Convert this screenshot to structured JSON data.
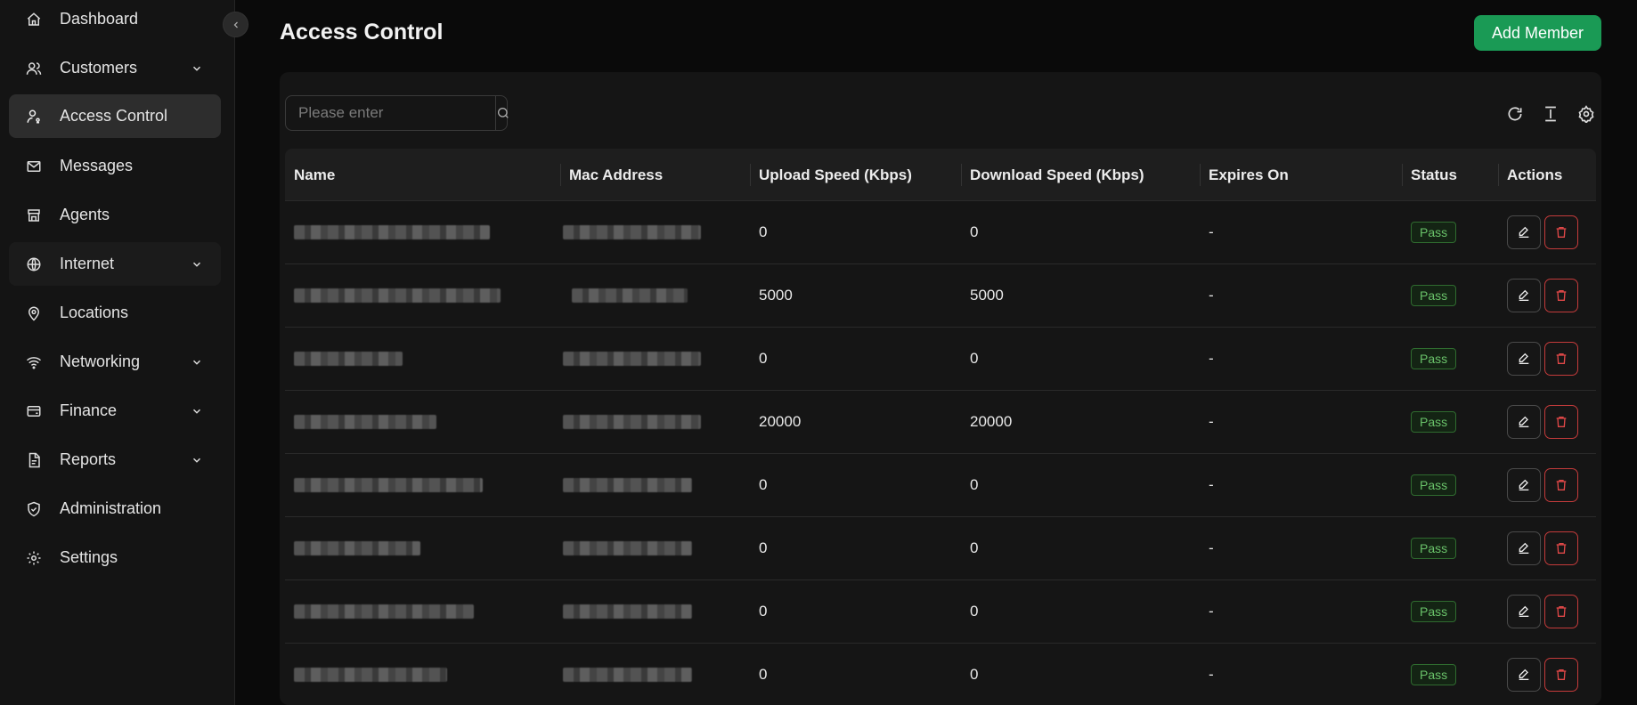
{
  "sidebar": {
    "items": [
      {
        "label": "Dashboard",
        "icon": "home-icon",
        "chevron": false
      },
      {
        "label": "Customers",
        "icon": "users-icon",
        "chevron": true
      },
      {
        "label": "Access Control",
        "icon": "user-key-icon",
        "chevron": false,
        "active": true
      },
      {
        "label": "Messages",
        "icon": "mail-icon",
        "chevron": false
      },
      {
        "label": "Agents",
        "icon": "store-icon",
        "chevron": false
      },
      {
        "label": "Internet",
        "icon": "globe-icon",
        "chevron": true
      },
      {
        "label": "Locations",
        "icon": "map-pin-icon",
        "chevron": false
      },
      {
        "label": "Networking",
        "icon": "wifi-icon",
        "chevron": true
      },
      {
        "label": "Finance",
        "icon": "wallet-icon",
        "chevron": true
      },
      {
        "label": "Reports",
        "icon": "file-report-icon",
        "chevron": true
      },
      {
        "label": "Administration",
        "icon": "shield-check-icon",
        "chevron": false
      },
      {
        "label": "Settings",
        "icon": "gear-icon",
        "chevron": false
      }
    ]
  },
  "header": {
    "title": "Access Control",
    "add_button": "Add Member"
  },
  "search": {
    "placeholder": "Please enter"
  },
  "table": {
    "columns": [
      "Name",
      "Mac Address",
      "Upload Speed (Kbps)",
      "Download Speed (Kbps)",
      "Expires On",
      "Status",
      "Actions"
    ],
    "rows": [
      {
        "upload": "0",
        "download": "0",
        "expires": "-",
        "status": "Pass"
      },
      {
        "upload": "5000",
        "download": "5000",
        "expires": "-",
        "status": "Pass"
      },
      {
        "upload": "0",
        "download": "0",
        "expires": "-",
        "status": "Pass"
      },
      {
        "upload": "20000",
        "download": "20000",
        "expires": "-",
        "status": "Pass"
      },
      {
        "upload": "0",
        "download": "0",
        "expires": "-",
        "status": "Pass"
      },
      {
        "upload": "0",
        "download": "0",
        "expires": "-",
        "status": "Pass"
      },
      {
        "upload": "0",
        "download": "0",
        "expires": "-",
        "status": "Pass"
      },
      {
        "upload": "0",
        "download": "0",
        "expires": "-",
        "status": "Pass"
      }
    ]
  },
  "colors": {
    "accent": "#1a9a55",
    "status_pass": "#6ac36a",
    "danger": "#c43b3b"
  }
}
